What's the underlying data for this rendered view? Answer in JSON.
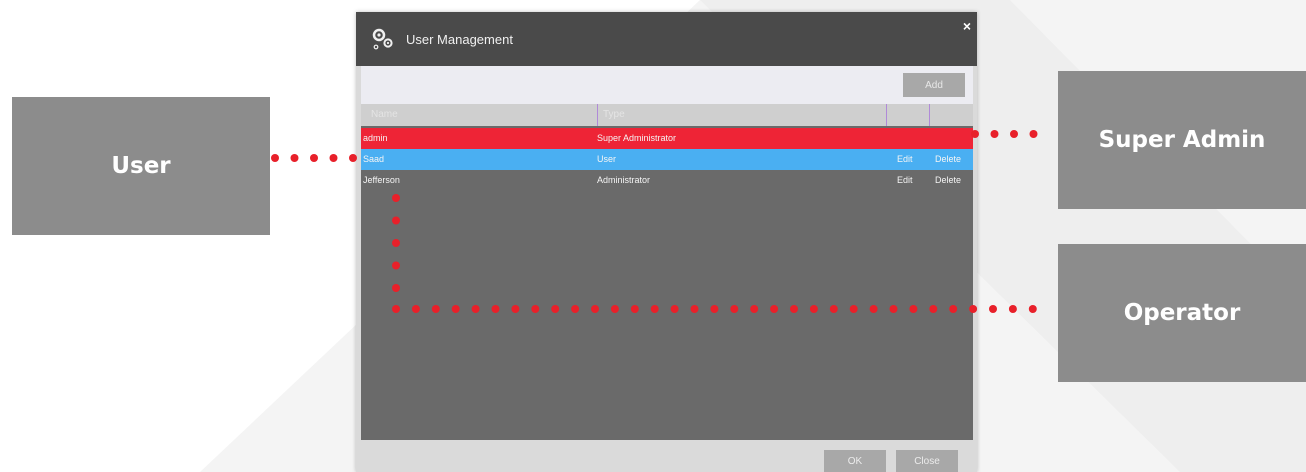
{
  "dialog": {
    "title": "User Management",
    "close_glyph": "×",
    "add_label": "Add",
    "ok_label": "OK",
    "close_label": "Close",
    "columns": [
      "Name",
      "Type"
    ],
    "rows": [
      {
        "name": "admin",
        "type": "Super Administrator",
        "edit": "",
        "delete": "",
        "state": "red"
      },
      {
        "name": "Saad",
        "type": "User",
        "edit": "Edit",
        "delete": "Delete",
        "state": "selected-blue"
      },
      {
        "name": "Jefferson",
        "type": "Administrator",
        "edit": "Edit",
        "delete": "Delete",
        "state": "normal"
      }
    ],
    "icon": "gears-icon"
  },
  "callouts": {
    "user": "User",
    "super_admin": "Super Admin",
    "operator": "Operator"
  },
  "colors": {
    "annotation_dots": "#e8202a",
    "row_red": "#ee2436",
    "row_blue": "#4aaff2",
    "callout_bg": "#8c8c8c"
  }
}
